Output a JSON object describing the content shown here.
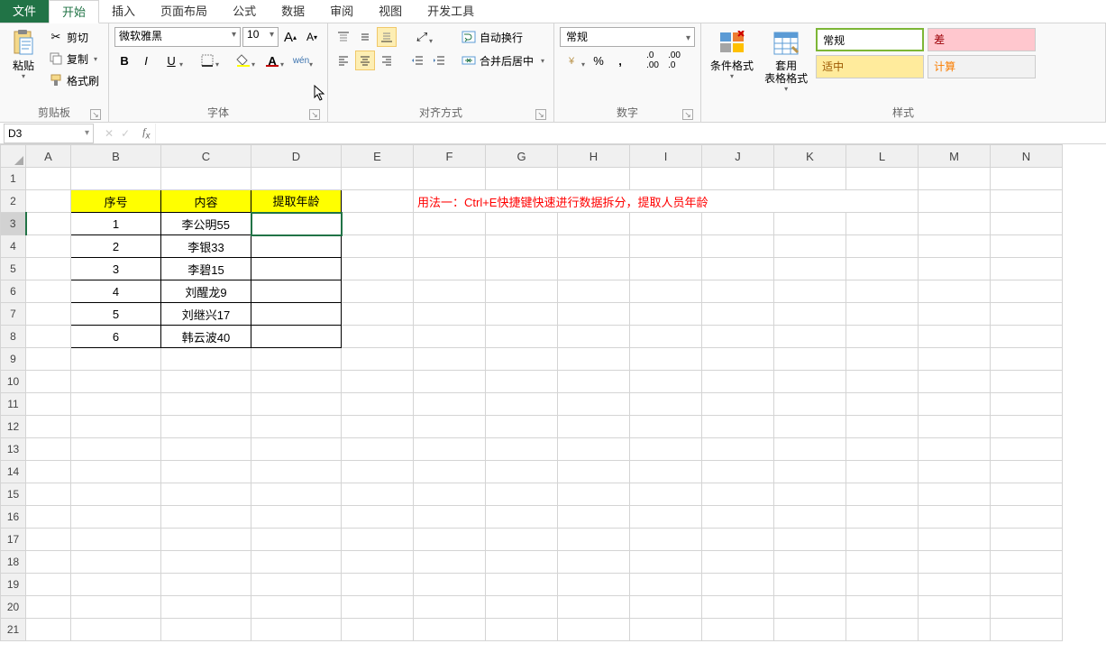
{
  "tabs": {
    "file": "文件",
    "home": "开始",
    "insert": "插入",
    "layout": "页面布局",
    "formula": "公式",
    "data": "数据",
    "review": "审阅",
    "view": "视图",
    "dev": "开发工具"
  },
  "clipboard": {
    "paste": "粘贴",
    "cut": "剪切",
    "copy": "复制",
    "format_painter": "格式刷",
    "group": "剪贴板"
  },
  "font": {
    "name": "微软雅黑",
    "size": "10",
    "group": "字体",
    "pinyin": "wén"
  },
  "align": {
    "wrap": "自动换行",
    "merge": "合并后居中",
    "group": "对齐方式"
  },
  "number": {
    "format": "常规",
    "group": "数字"
  },
  "styles": {
    "cond": "条件格式",
    "table": "套用\n表格格式",
    "normal": "常规",
    "bad": "差",
    "good": "适中",
    "calc": "计算",
    "group": "样式"
  },
  "cellref": "D3",
  "sheet": {
    "headers": {
      "b": "序号",
      "c": "内容",
      "d": "提取年龄"
    },
    "rows": [
      {
        "b": "1",
        "c": "李公明55",
        "d": ""
      },
      {
        "b": "2",
        "c": "李银33",
        "d": ""
      },
      {
        "b": "3",
        "c": "李碧15",
        "d": ""
      },
      {
        "b": "4",
        "c": "刘醒龙9",
        "d": ""
      },
      {
        "b": "5",
        "c": "刘继兴17",
        "d": ""
      },
      {
        "b": "6",
        "c": "韩云波40",
        "d": ""
      }
    ],
    "note": "用法一：Ctrl+E快捷键快速进行数据拆分，提取人员年龄"
  },
  "cols": [
    "A",
    "B",
    "C",
    "D",
    "E",
    "F",
    "G",
    "H",
    "I",
    "J",
    "K",
    "L",
    "M",
    "N"
  ]
}
